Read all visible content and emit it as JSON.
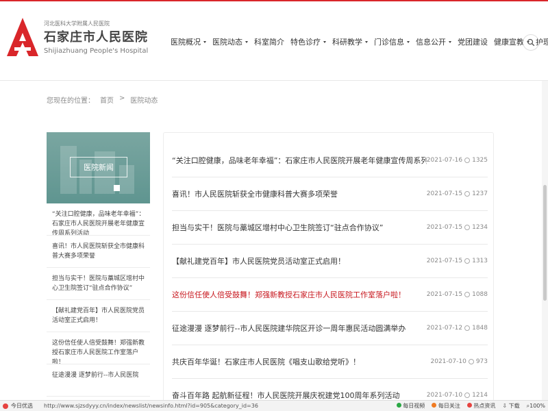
{
  "header": {
    "logo_small": "河北医科大学附属人民医院",
    "logo_cn": "石家庄市人民医院",
    "logo_en": "Shijiazhuang People's Hospital",
    "nav": [
      {
        "label": "医院概况",
        "dropdown": true
      },
      {
        "label": "医院动态",
        "dropdown": true
      },
      {
        "label": "科室简介",
        "dropdown": false
      },
      {
        "label": "特色诊疗",
        "dropdown": true
      },
      {
        "label": "科研教学",
        "dropdown": true
      },
      {
        "label": "门诊信息",
        "dropdown": true
      },
      {
        "label": "信息公开",
        "dropdown": true
      },
      {
        "label": "党团建设",
        "dropdown": false
      },
      {
        "label": "健康宣教",
        "dropdown": true
      },
      {
        "label": "护理之窗",
        "dropdown": true
      }
    ],
    "brand_color": "#d9262a"
  },
  "breadcrumb": {
    "prefix": "您现在的位置：",
    "home": "首页",
    "separator": ">",
    "current": "医院动态"
  },
  "sidebar": {
    "title": "医院新闻",
    "items": [
      {
        "text": "“关注口腔健康，品味老年幸福”：石家庄市人民医院开展老年健康宣传周系列活动",
        "red": false
      },
      {
        "text": "喜讯！市人民医院斩获全市健康科普大赛多项荣誉",
        "red": false
      },
      {
        "text": "担当与实干！医院与藁城区增村中心卫生院签订“驻点合作协议”",
        "red": false
      },
      {
        "text": "【献礼建党百年】市人民医院党员活动室正式启用！",
        "red": false
      },
      {
        "text": "这份信任使人倍受鼓舞！郑强新教授石家庄市人民医院工作室落户啦！",
        "red": false
      },
      {
        "text": "征途漫漫 逐梦前行--市人民医院",
        "red": false
      }
    ]
  },
  "news": [
    {
      "title": "“关注口腔健康，品味老年幸福”：石家庄市人民医院开展老年健康宣传周系列活动",
      "date": "2021-07-16",
      "views": "1325",
      "red": false
    },
    {
      "title": "喜讯！市人民医院斩获全市健康科普大赛多项荣誉",
      "date": "2021-07-15",
      "views": "1237",
      "red": false
    },
    {
      "title": "担当与实干！医院与藁城区增村中心卫生院签订“驻点合作协议”",
      "date": "2021-07-15",
      "views": "1234",
      "red": false
    },
    {
      "title": "【献礼建党百年】市人民医院党员活动室正式启用！",
      "date": "2021-07-15",
      "views": "1313",
      "red": false
    },
    {
      "title": "这份信任使人倍受鼓舞！郑强新教授石家庄市人民医院工作室落户啦！",
      "date": "2021-07-15",
      "views": "1088",
      "red": true
    },
    {
      "title": "征途漫漫 逐梦前行--市人民医院建华院区开诊一周年惠民活动圆满举办",
      "date": "2021-07-12",
      "views": "1848",
      "red": false
    },
    {
      "title": "共庆百年华诞！石家庄市人民医院《唱支山歌给党听》！",
      "date": "2021-07-10",
      "views": "973",
      "red": false
    },
    {
      "title": "奋斗百年路 起航新征程！市人民医院开展庆祝建党100周年系列活动",
      "date": "2021-07-10",
      "views": "1214",
      "red": false
    }
  ],
  "statusbar": {
    "left_label": "今日优选",
    "url": "http://www.sjzsdyyy.cn/index/newslist/newsinfo.html?id=905&category_id=36",
    "items": [
      "每日视频",
      "每日关注",
      "热点资讯",
      "下载",
      "100%"
    ]
  }
}
